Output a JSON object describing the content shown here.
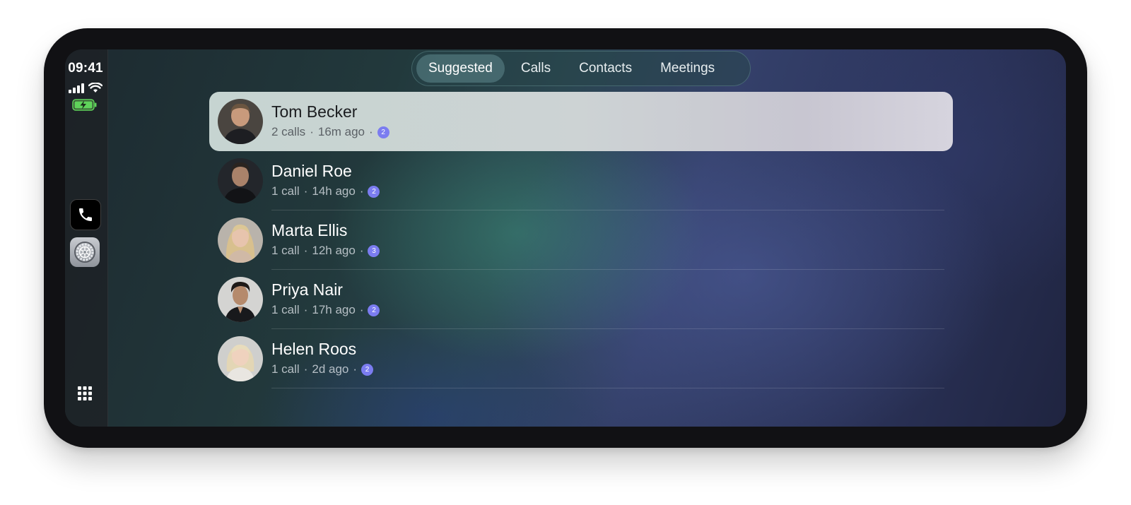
{
  "status_bar": {
    "time": "09:41"
  },
  "sidebar": {
    "apps": [
      {
        "name": "Phone",
        "icon": "phone-icon"
      },
      {
        "name": "Settings",
        "icon": "gear-icon"
      }
    ],
    "bottom_icon": "app-grid-icon"
  },
  "tabs": {
    "items": [
      "Suggested",
      "Calls",
      "Contacts",
      "Meetings"
    ],
    "active": "Suggested"
  },
  "contacts": [
    {
      "name": "Tom Becker",
      "calls": "2 calls",
      "when": "16m ago",
      "sep1": "·",
      "sep2": "·",
      "badge": "2",
      "selected": true
    },
    {
      "name": "Daniel Roe",
      "calls": "1 call",
      "when": "14h ago",
      "sep1": "·",
      "sep2": "·",
      "badge": "2",
      "selected": false
    },
    {
      "name": "Marta Ellis",
      "calls": "1 call",
      "when": "12h ago",
      "sep1": "·",
      "sep2": "·",
      "badge": "3",
      "selected": false
    },
    {
      "name": "Priya Nair",
      "calls": "1 call",
      "when": "17h ago",
      "sep1": "·",
      "sep2": "·",
      "badge": "2",
      "selected": false
    },
    {
      "name": "Helen Roos",
      "calls": "1 call",
      "when": "2d ago",
      "sep1": "·",
      "sep2": "·",
      "badge": "2",
      "selected": false
    }
  ],
  "colors": {
    "badge": "#7b7cf0",
    "battery": "#5fd35a",
    "selected_row": "#cdd3d4"
  }
}
